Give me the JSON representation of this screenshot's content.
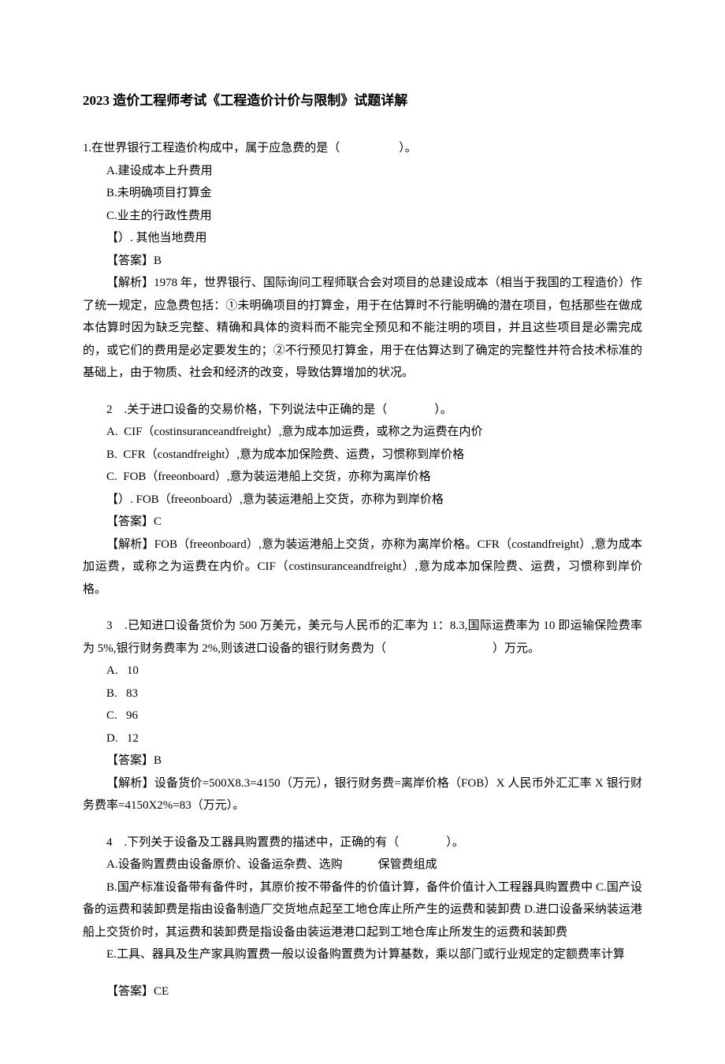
{
  "title": "2023 造价工程师考试《工程造价计价与限制》试题详解",
  "q1": {
    "stem": "1.在世界银行工程造价构成中，属于应急费的是（　　　　　）。",
    "optA": "A.建设成本上升费用",
    "optB": "B.未明确项目打算金",
    "optC": "C.业主的行政性费用",
    "optD": "【）. 其他当地费用",
    "answer": "【答案】B",
    "explain": "【解析】1978 年，世界银行、国际询问工程师联合会对项目的总建设成本（相当于我国的工程造价）作了统一规定，应急费包括：①未明确项目的打算金，用于在估算时不行能明确的潜在项目，包括那些在做成本估算时因为缺乏完整、精确和具体的资料而不能完全预见和不能注明的项目，并且这些项目是必需完成的，或它们的费用是必定要发生的；②不行预见打算金，用于在估算达到了确定的完整性并符合技术标准的基础上，由于物质、社会和经济的改变，导致估算增加的状况。"
  },
  "q2": {
    "stem": "2　.关于进口设备的交易价格，下列说法中正确的是（　　　　）。",
    "optA": "A. CIF（costinsuranceandfreight）,意为成本加运费，或称之为运费在内价",
    "optB": "B. CFR（costandfreight）,意为成本加保险费、运费，习惯称到岸价格",
    "optC": "C. FOB（freeonboard）,意为装运港船上交货，亦称为离岸价格",
    "optD": "【）. FOB（freeonboard）,意为装运港船上交货，亦称为到岸价格",
    "answer": "【答案】C",
    "explain": "【解析】FOB（freeonboard）,意为装运港船上交货，亦称为离岸价格。CFR（costandfreight）,意为成本加运费，或称之为运费在内价。CIF（costinsuranceandfreight）,意为成本加保险费、运费，习惯称到岸价格。"
  },
  "q3": {
    "stem": "3　.已知进口设备货价为 500 万美元，美元与人民币的汇率为 1：8.3,国际运费率为 10 即运输保险费率为 5%,银行财务费率为 2%,则该进口设备的银行财务费为（　　　　　　　　　）万元。",
    "optA": "A.  10",
    "optB": "B.  83",
    "optC": "C.  96",
    "optD": "D.  12",
    "answer": "【答案】B",
    "explain": "【解析】设备货价=500X8.3=4150（万元），银行财务费=离岸价格（FOB）X 人民币外汇汇率 X 银行财务费率=4150X2%=83（万元）。"
  },
  "q4": {
    "stem": "4　.下列关于设备及工器具购置费的描述中，正确的有（　　　　）。",
    "optA": "A.设备购置费由设备原价、设备运杂费、选购　　　保管费组成",
    "optBCD": "B.国产标准设备带有备件时，其原价按不带备件的价值计算，备件价值计入工程器具购置费中 C.国产设备的运费和装卸费是指由设备制造厂交货地点起至工地仓库止所产生的运费和装卸费 D.进口设备采纳装运港船上交货价时，其运费和装卸费是指设备由装运港港口起到工地仓库止所发生的运费和装卸费",
    "optE": "E.工具、器具及生产家具购置费一般以设备购置费为计算基数，乘以部门或行业规定的定额费率计算",
    "answer": "【答案】CE"
  }
}
